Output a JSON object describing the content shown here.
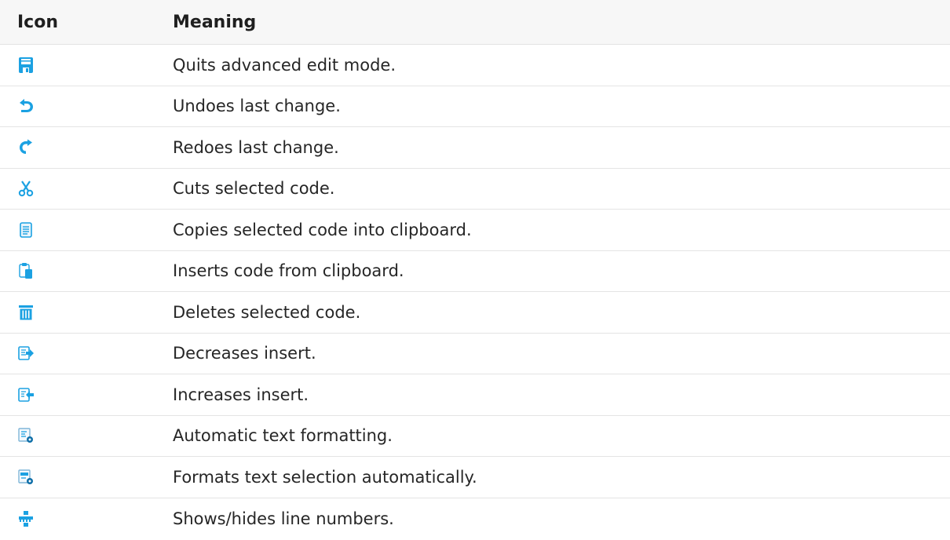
{
  "header": {
    "icon": "Icon",
    "meaning": "Meaning"
  },
  "rows": [
    {
      "icon": "save-icon",
      "meaning": "Quits advanced edit mode."
    },
    {
      "icon": "undo-icon",
      "meaning": "Undoes last change."
    },
    {
      "icon": "redo-icon",
      "meaning": "Redoes last change."
    },
    {
      "icon": "scissors-icon",
      "meaning": "Cuts selected code."
    },
    {
      "icon": "copy-icon",
      "meaning": "Copies selected code into clipboard."
    },
    {
      "icon": "paste-icon",
      "meaning": "Inserts code from clipboard."
    },
    {
      "icon": "trash-icon",
      "meaning": "Deletes selected code."
    },
    {
      "icon": "outdent-icon",
      "meaning": "Decreases insert."
    },
    {
      "icon": "indent-icon",
      "meaning": "Increases insert."
    },
    {
      "icon": "auto-format-icon",
      "meaning": "Automatic text formatting."
    },
    {
      "icon": "format-selection-icon",
      "meaning": "Formats text selection automatically."
    },
    {
      "icon": "line-numbers-icon",
      "meaning": "Shows/hides line numbers."
    }
  ],
  "colors": {
    "icon_blue": "#1ba1e2",
    "icon_dark_blue": "#0f6fa8",
    "icon_gray": "#8a8a8a",
    "header_bg": "#f7f7f7",
    "row_border": "#e4e4e4"
  }
}
